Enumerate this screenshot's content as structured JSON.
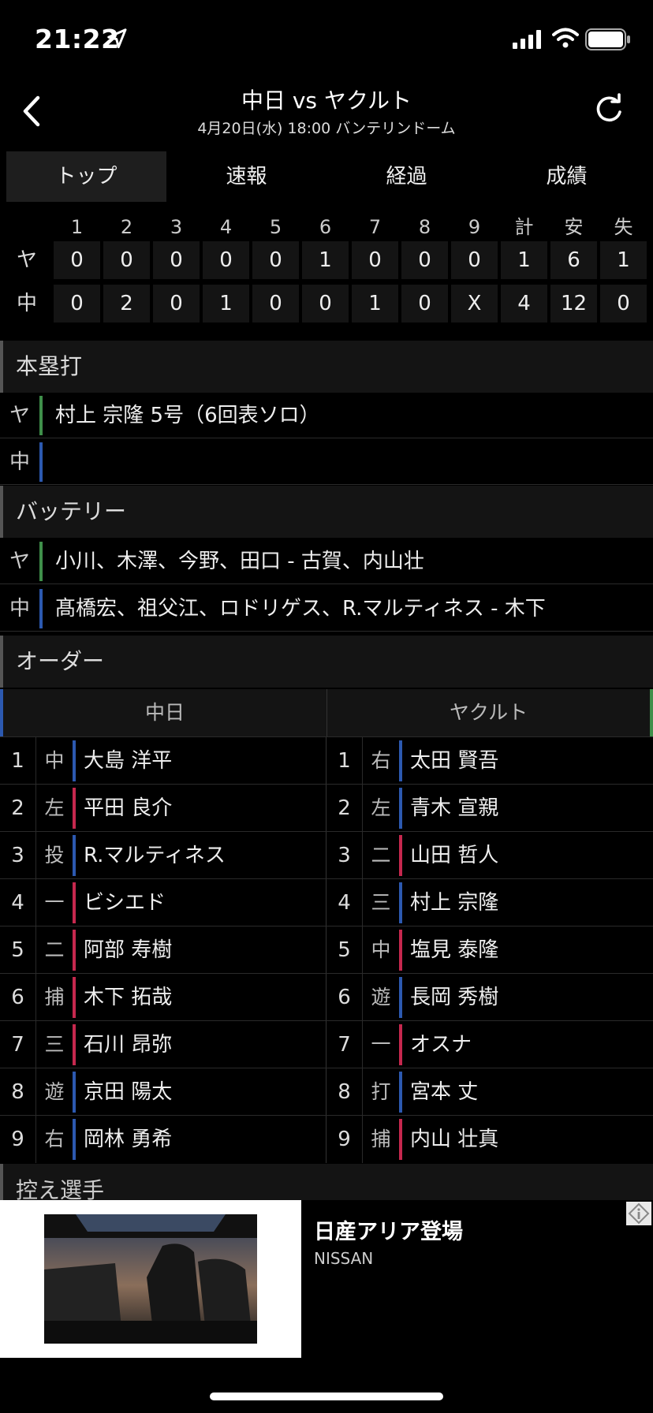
{
  "status": {
    "time": "21:22"
  },
  "header": {
    "title": "中日 vs ヤクルト",
    "subtitle": "4月20日(水) 18:00 バンテリンドーム"
  },
  "tabs": [
    {
      "label": "トップ",
      "active": true
    },
    {
      "label": "速報",
      "active": false
    },
    {
      "label": "経過",
      "active": false
    },
    {
      "label": "成績",
      "active": false
    }
  ],
  "scoreboard": {
    "columns": [
      "1",
      "2",
      "3",
      "4",
      "5",
      "6",
      "7",
      "8",
      "9",
      "計",
      "安",
      "失"
    ],
    "rows": [
      {
        "team": "ヤ",
        "cells": [
          "0",
          "0",
          "0",
          "0",
          "0",
          "1",
          "0",
          "0",
          "0",
          "1",
          "6",
          "1"
        ]
      },
      {
        "team": "中",
        "cells": [
          "0",
          "2",
          "0",
          "1",
          "0",
          "0",
          "1",
          "0",
          "X",
          "4",
          "12",
          "0"
        ]
      }
    ]
  },
  "homeruns": {
    "title": "本塁打",
    "rows": [
      {
        "team": "ヤ",
        "text": "村上 宗隆 5号（6回表ソロ）"
      },
      {
        "team": "中",
        "text": ""
      }
    ]
  },
  "battery": {
    "title": "バッテリー",
    "rows": [
      {
        "team": "ヤ",
        "text": "小川、木澤、今野、田口 - 古賀、内山壮"
      },
      {
        "team": "中",
        "text": "髙橋宏、祖父江、ロドリゲス、R.マルティネス - 木下"
      }
    ]
  },
  "order": {
    "title": "オーダー",
    "home_team": "中日",
    "away_team": "ヤクルト",
    "home": [
      {
        "num": "1",
        "pos": "中",
        "name": "大島 洋平",
        "bat": "blue"
      },
      {
        "num": "2",
        "pos": "左",
        "name": "平田 良介",
        "bat": "red"
      },
      {
        "num": "3",
        "pos": "投",
        "name": "R.マルティネス",
        "bat": "blue"
      },
      {
        "num": "4",
        "pos": "一",
        "name": "ビシエド",
        "bat": "red"
      },
      {
        "num": "5",
        "pos": "二",
        "name": "阿部 寿樹",
        "bat": "red"
      },
      {
        "num": "6",
        "pos": "捕",
        "name": "木下 拓哉",
        "bat": "red"
      },
      {
        "num": "7",
        "pos": "三",
        "name": "石川 昂弥",
        "bat": "red"
      },
      {
        "num": "8",
        "pos": "遊",
        "name": "京田 陽太",
        "bat": "blue"
      },
      {
        "num": "9",
        "pos": "右",
        "name": "岡林 勇希",
        "bat": "blue"
      }
    ],
    "away": [
      {
        "num": "1",
        "pos": "右",
        "name": "太田 賢吾",
        "bat": "blue"
      },
      {
        "num": "2",
        "pos": "左",
        "name": "青木 宣親",
        "bat": "blue"
      },
      {
        "num": "3",
        "pos": "二",
        "name": "山田 哲人",
        "bat": "red"
      },
      {
        "num": "4",
        "pos": "三",
        "name": "村上 宗隆",
        "bat": "blue"
      },
      {
        "num": "5",
        "pos": "中",
        "name": "塩見 泰隆",
        "bat": "red"
      },
      {
        "num": "6",
        "pos": "遊",
        "name": "長岡 秀樹",
        "bat": "blue"
      },
      {
        "num": "7",
        "pos": "一",
        "name": "オスナ",
        "bat": "red"
      },
      {
        "num": "8",
        "pos": "打",
        "name": "宮本 丈",
        "bat": "blue"
      },
      {
        "num": "9",
        "pos": "捕",
        "name": "内山 壮真",
        "bat": "red"
      }
    ]
  },
  "bench": {
    "title": "控え選手"
  },
  "ad": {
    "title": "日産アリア登場",
    "brand": "NISSAN"
  },
  "colors": {
    "green": "#3f8f4a",
    "blue": "#2c59b0",
    "red": "#c6284e"
  },
  "icons": [
    "location-arrow-icon",
    "signal-icon",
    "wifi-icon",
    "battery-icon",
    "back-chevron-icon",
    "refresh-icon",
    "ad-info-icon"
  ]
}
